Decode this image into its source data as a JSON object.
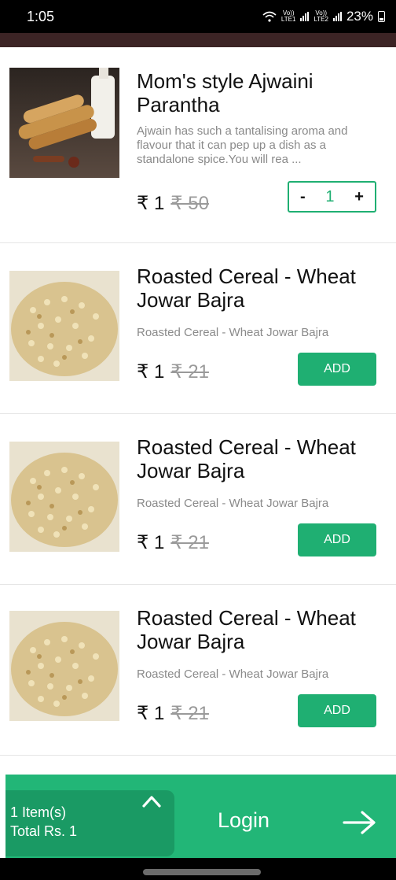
{
  "status_bar": {
    "time": "1:05",
    "sim1_top": "Vo))",
    "sim1_bottom": "LTE1",
    "sim2_top": "Vo))",
    "sim2_bottom": "LTE2",
    "battery": "23%"
  },
  "products": [
    {
      "title": "Mom's style Ajwaini Parantha",
      "description": "Ajwain has such a tantalising aroma and flavour that it can pep up a dish as a standalone spice.You will rea ...",
      "price": "₹ 1",
      "original_price": "₹ 50",
      "in_cart": true,
      "quantity": "1",
      "minus_label": "-",
      "plus_label": "+"
    },
    {
      "title": "Roasted Cereal - Wheat Jowar Bajra",
      "description": "Roasted Cereal - Wheat Jowar Bajra",
      "price": "₹ 1",
      "original_price": "₹ 21",
      "add_label": "ADD"
    },
    {
      "title": "Roasted Cereal - Wheat Jowar Bajra",
      "description": "Roasted Cereal - Wheat Jowar Bajra",
      "price": "₹ 1",
      "original_price": "₹ 21",
      "add_label": "ADD"
    },
    {
      "title": "Roasted Cereal - Wheat Jowar Bajra",
      "description": "Roasted Cereal - Wheat Jowar Bajra",
      "price": "₹ 1",
      "original_price": "₹ 21",
      "add_label": "ADD"
    }
  ],
  "cart_bar": {
    "items_text": "1 Item(s)",
    "total_text": "Total Rs. 1",
    "login_label": "Login",
    "expand_icon": "chevron-up-icon",
    "proceed_icon": "arrow-right-icon"
  },
  "colors": {
    "accent": "#1faf72",
    "cart_bar": "#22b677",
    "summary_panel": "#1a9a64",
    "app_bar": "#3c2425"
  }
}
